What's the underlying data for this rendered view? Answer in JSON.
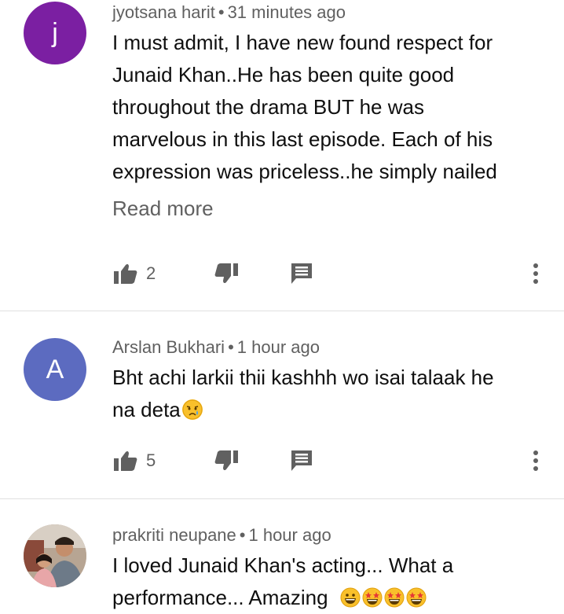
{
  "comments": [
    {
      "author": "jyotsana harit",
      "time": "31 minutes ago",
      "avatar_letter": "j",
      "avatar_color": "#7b1fa2",
      "lines": [
        "I must admit, I have new found respect for",
        "Junaid Khan..He has been quite good",
        "throughout the drama BUT he was",
        "marvelous in this last episode. Each of his",
        "expression was priceless..he simply nailed"
      ],
      "read_more": "Read more",
      "likes": "2"
    },
    {
      "author": "Arslan Bukhari",
      "time": "1 hour ago",
      "avatar_letter": "A",
      "avatar_color": "#5c6bc0",
      "lines": [
        "Bht achi larkii thii kashhh wo isai talaak he",
        "na deta"
      ],
      "emoji": "crying-face",
      "likes": "5"
    },
    {
      "author": "prakriti neupane",
      "time": "1 hour ago",
      "avatar_type": "photo",
      "lines": [
        "I loved Junaid Khan's acting... What a",
        "performance... Amazing"
      ],
      "emojis": [
        "grinning-face",
        "star-struck",
        "star-struck",
        "star-struck"
      ]
    }
  ],
  "separator": "•"
}
